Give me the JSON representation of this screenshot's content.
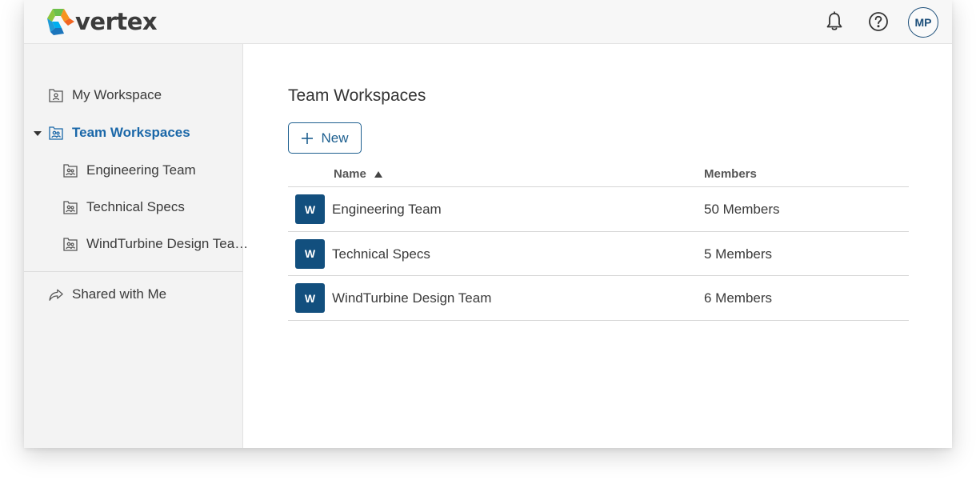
{
  "app": {
    "brand": "vertex",
    "colors": {
      "accent": "#1a67a8",
      "badge": "#124f7e",
      "logo_green": "#6cc04a",
      "logo_orange": "#f7941d",
      "logo_blue": "#1f9bd7"
    }
  },
  "header": {
    "icons": [
      "bell-icon",
      "help-icon"
    ],
    "avatar_initials": "MP"
  },
  "sidebar": {
    "my_workspace": "My Workspace",
    "team_workspaces": "Team Workspaces",
    "children": [
      "Engineering Team",
      "Technical Specs",
      "WindTurbine Design Tea…"
    ],
    "shared": "Shared with Me"
  },
  "main": {
    "title": "Team Workspaces",
    "new_label": "New",
    "columns": {
      "name": "Name",
      "members": "Members"
    },
    "rows": [
      {
        "badge": "W",
        "name": "Engineering Team",
        "members": "50 Members"
      },
      {
        "badge": "W",
        "name": "Technical Specs",
        "members": "5 Members"
      },
      {
        "badge": "W",
        "name": "WindTurbine Design Team",
        "members": "6 Members"
      }
    ]
  }
}
